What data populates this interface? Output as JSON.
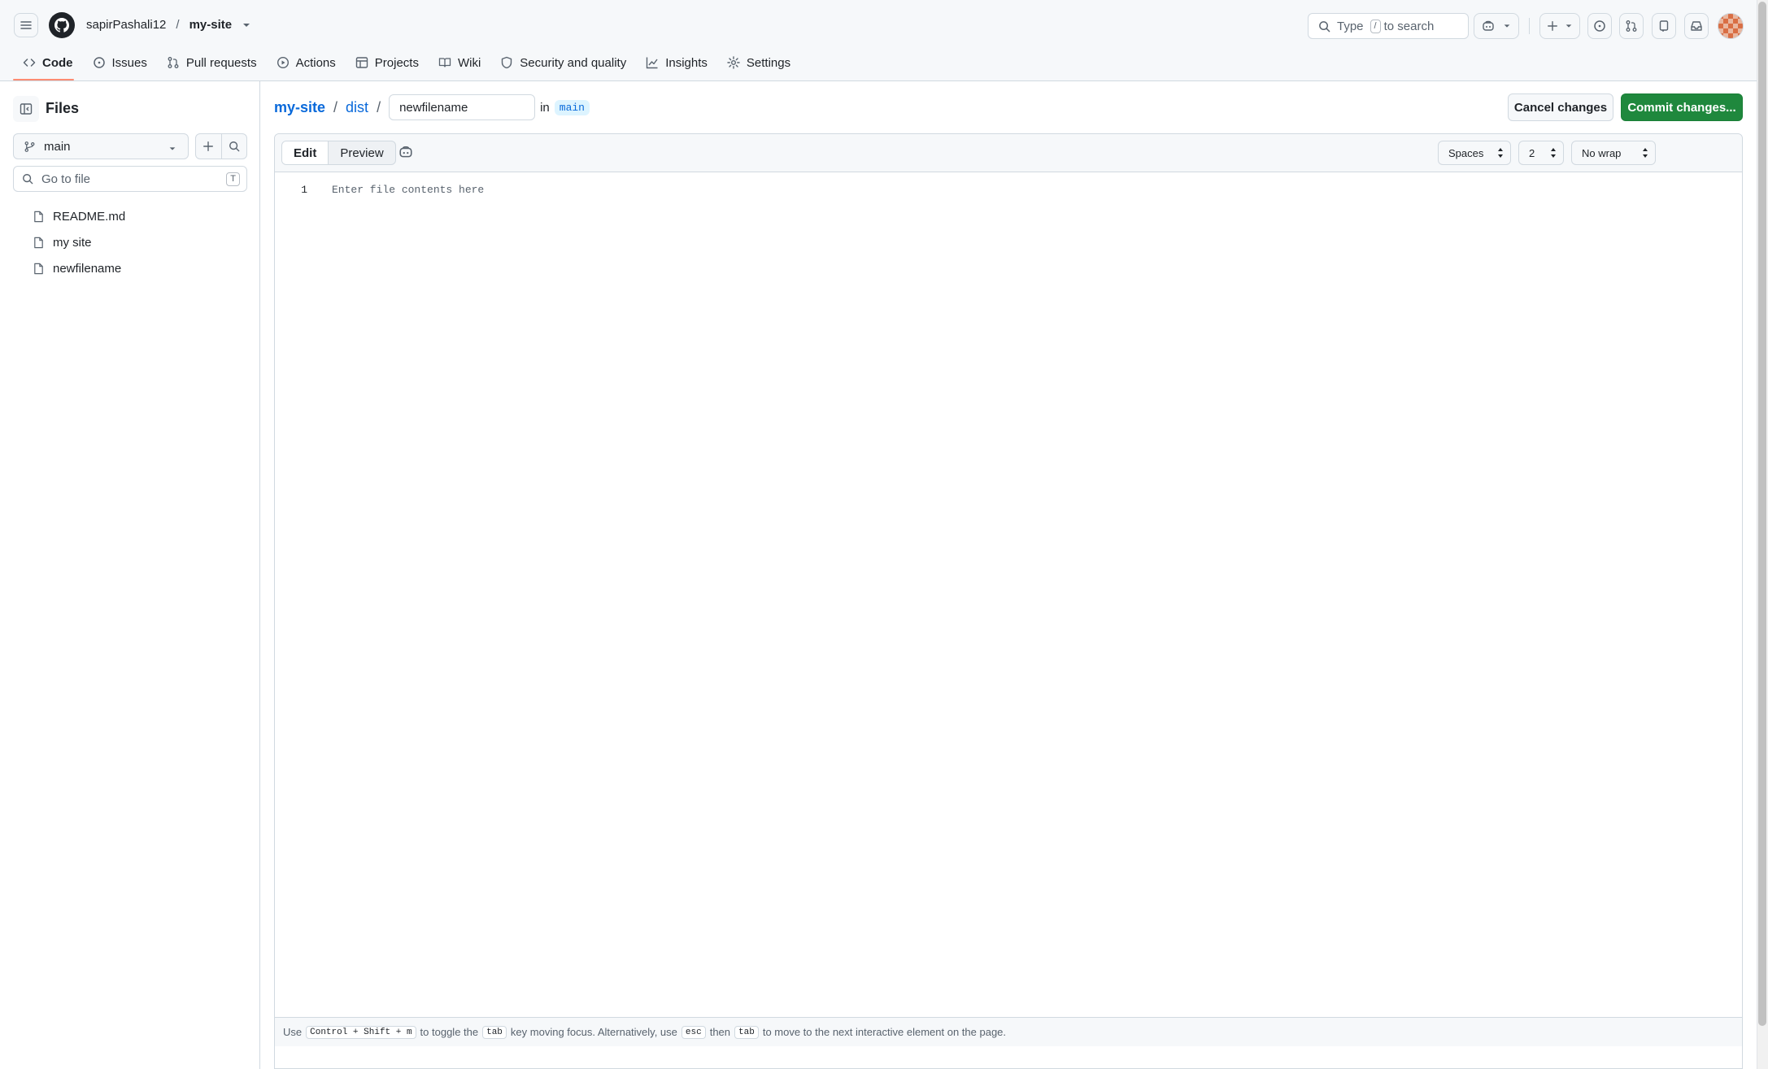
{
  "header": {
    "owner": "sapirPashali12",
    "separator": "/",
    "repo": "my-site",
    "search": {
      "prefix": "Type",
      "key": "/",
      "suffix": "to search"
    }
  },
  "repo_nav": {
    "items": [
      {
        "label": "Code",
        "icon": "code-icon",
        "active": true
      },
      {
        "label": "Issues",
        "icon": "issue-opened-icon"
      },
      {
        "label": "Pull requests",
        "icon": "git-pull-request-icon"
      },
      {
        "label": "Actions",
        "icon": "play-icon"
      },
      {
        "label": "Projects",
        "icon": "table-icon"
      },
      {
        "label": "Wiki",
        "icon": "book-icon"
      },
      {
        "label": "Security and quality",
        "icon": "shield-icon"
      },
      {
        "label": "Insights",
        "icon": "graph-icon"
      },
      {
        "label": "Settings",
        "icon": "gear-icon"
      }
    ],
    "accent": "#fd8c73"
  },
  "sidebar": {
    "title": "Files",
    "branch": "main",
    "goto_placeholder": "Go to file",
    "goto_shortcut": "T",
    "files": [
      "README.md",
      "my site",
      "newfilename"
    ]
  },
  "main": {
    "path": {
      "repo": "my-site",
      "folder": "dist",
      "sep": "/"
    },
    "filename_value": "newfilename",
    "in_label": "in",
    "branch": "main",
    "cancel_label": "Cancel changes",
    "commit_label": "Commit changes...",
    "commit_color": "#1f883d"
  },
  "editor": {
    "tabs": {
      "edit": "Edit",
      "preview": "Preview"
    },
    "indent_mode": "Spaces",
    "indent_size": "2",
    "wrap_mode": "No wrap",
    "line_number": "1",
    "placeholder": "Enter file contents here",
    "footer": {
      "t1": "Use",
      "k1": "Control + Shift + m",
      "t2": "to toggle the",
      "k2": "tab",
      "t3": "key moving focus. Alternatively, use",
      "k3": "esc",
      "t4": "then",
      "k4": "tab",
      "t5": "to move to the next interactive element on the page."
    }
  }
}
